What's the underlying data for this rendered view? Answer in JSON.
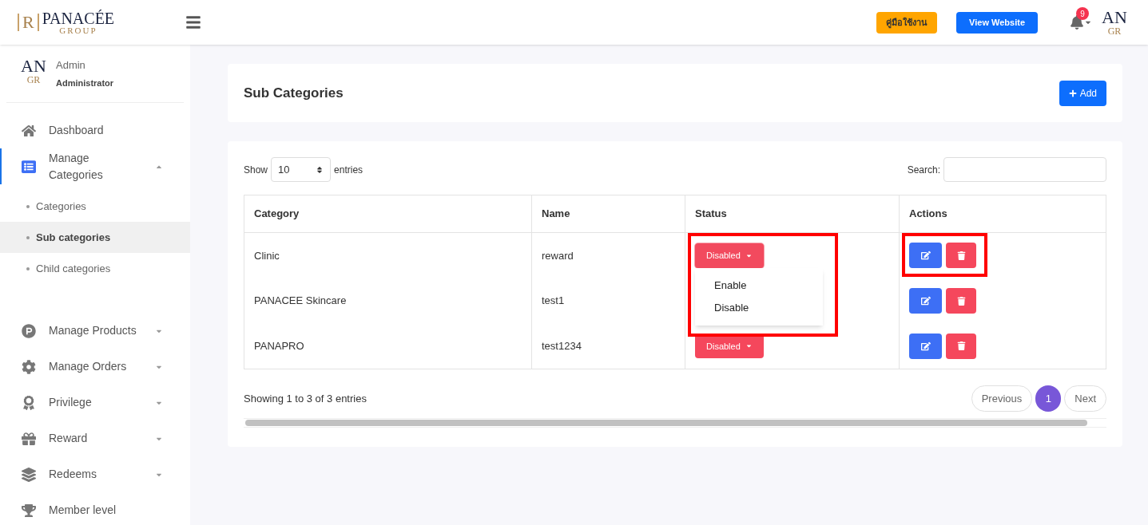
{
  "header": {
    "logo": {
      "title": "PANACÉE",
      "subtitle": "GROUP",
      "seal": "R"
    },
    "guide_button": "คู่มือใช้งาน",
    "view_button": "View Website",
    "notifications": "9",
    "avatar": {
      "line1": "AN",
      "line2": "GR"
    }
  },
  "sidebar": {
    "user": {
      "avatar": {
        "line1": "AN",
        "line2": "GR"
      },
      "name": "Admin",
      "role": "Administrator"
    },
    "items": [
      {
        "label": "Dashboard",
        "active": false
      },
      {
        "label": "Manage Categories",
        "active": true,
        "expanded": true,
        "children": [
          {
            "label": "Categories",
            "selected": false
          },
          {
            "label": "Sub categories",
            "selected": true
          },
          {
            "label": "Child categories",
            "selected": false
          }
        ]
      },
      {
        "label": "Manage Products",
        "active": false,
        "expanded": false
      },
      {
        "label": "Manage Orders",
        "active": false,
        "expanded": false
      },
      {
        "label": "Privilege",
        "active": false,
        "expanded": false
      },
      {
        "label": "Reward",
        "active": false,
        "expanded": false
      },
      {
        "label": "Redeems",
        "active": false,
        "expanded": false
      },
      {
        "label": "Member level",
        "active": false
      }
    ]
  },
  "page": {
    "title": "Sub Categories",
    "add_button": "Add"
  },
  "table": {
    "show_label": "Show",
    "page_size": "10",
    "entries_label": "entries",
    "search_label": "Search:",
    "columns": [
      "Category",
      "Name",
      "Status",
      "Actions"
    ],
    "rows": [
      {
        "category": "Clinic",
        "name": "reward",
        "status": "Disabled",
        "menu_open": true,
        "status_highlighted": true,
        "actions_highlighted": true
      },
      {
        "category": "PANACEE Skincare",
        "name": "test1",
        "status_highlighted": false,
        "actions_highlighted": false
      },
      {
        "category": "PANAPRO",
        "name": "test1234",
        "status": "Disabled",
        "menu_open": false,
        "status_highlighted": false,
        "actions_highlighted": false
      }
    ],
    "status_menu": [
      "Enable",
      "Disable"
    ],
    "info": "Showing 1 to 3 of 3 entries",
    "pagination": [
      {
        "label": "Previous",
        "selected": false
      },
      {
        "label": "1",
        "selected": true
      },
      {
        "label": "Next",
        "selected": false
      }
    ]
  }
}
